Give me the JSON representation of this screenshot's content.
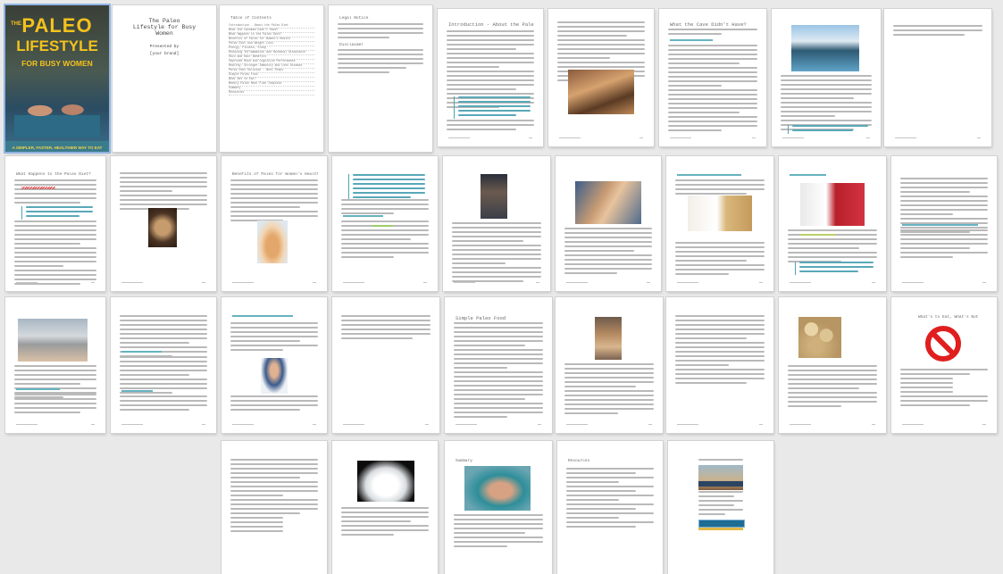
{
  "document": {
    "cover": {
      "title_line1": "PALEO",
      "title_the": "THE",
      "title_line2": "LIFESTYLE",
      "title_line3": "FOR BUSY WOMEN",
      "tagline": "A SIMPLER, FASTER, HEALTHIER WAY TO EAT"
    },
    "title_page": {
      "title": "The Paleo Lifestyle for Busy Women",
      "presented_by": "Presented by",
      "author": "[your brand]"
    },
    "toc": {
      "heading": "Table of Contents",
      "entries": [
        "Introduction - About the Paleo Diet",
        "What the Caveman Didn't Have?",
        "What Happens to the Paleo Diet?",
        "Benefits of Paleo for Women's Health",
        "Paleo Diet and Weight Loss",
        "Energy, Fitness, Sleep",
        "Reducing Inflammation and Hormonal Disbalance",
        "Skin and Hair Benefits",
        "Improved Mood and Cognitive Performance",
        "Healthy: Stronger Immunity and Less Disease",
        "Paleo Diet Solution - Next Steps",
        "Simple Paleo Food",
        "What Not to Eat?",
        "Weekly Paleo Meal Plan Template",
        "Summary",
        "Resources"
      ]
    },
    "pages": {
      "p4_heading": "Legal Notice",
      "p4_subhead": "Disclaimer",
      "p5_heading": "Introduction - About the Paleo Diet",
      "p7_heading": "What the Cave Didn't Have?",
      "p10_heading": "What Happens to the Paleo Diet?",
      "p12_heading": "Benefits of Paleo for Women's Health",
      "p25_heading": "Simple Paleo Food",
      "p26_heading": "What's to Eat, What's Not",
      "p30_heading": "Summary",
      "p31_heading": "Resources"
    }
  }
}
